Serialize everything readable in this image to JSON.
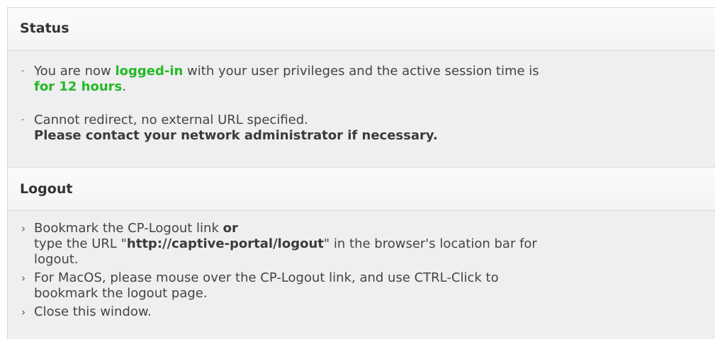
{
  "status": {
    "title": "Status",
    "items": [
      {
        "marker": "·",
        "prefix": "You are now ",
        "highlight1": "logged-in",
        "middle": " with your user privileges and the active session time is",
        "highlight2": "for 12 hours",
        "suffix": "."
      },
      {
        "marker": "·",
        "line1": "Cannot redirect, no external URL specified.",
        "line2": "Please contact your network administrator if necessary."
      }
    ]
  },
  "logout": {
    "title": "Logout",
    "items": [
      {
        "marker": "›",
        "line1_prefix": "Bookmark the CP-Logout link ",
        "line1_bold": "or",
        "line2_prefix": "type the URL \"",
        "url": "http://captive-portal/logout",
        "line2_suffix": "\" in the browser's location bar for",
        "line3": "logout."
      },
      {
        "marker": "›",
        "line1": "For MacOS, please mouse over the CP-Logout link, and use CTRL-Click to",
        "line2": "bookmark the logout page."
      },
      {
        "marker": "›",
        "line1": "Close this window."
      }
    ]
  },
  "colors": {
    "highlight_green": "#22bb22",
    "panel_bg": "#efeef1",
    "header_bg": "#fafafa"
  }
}
